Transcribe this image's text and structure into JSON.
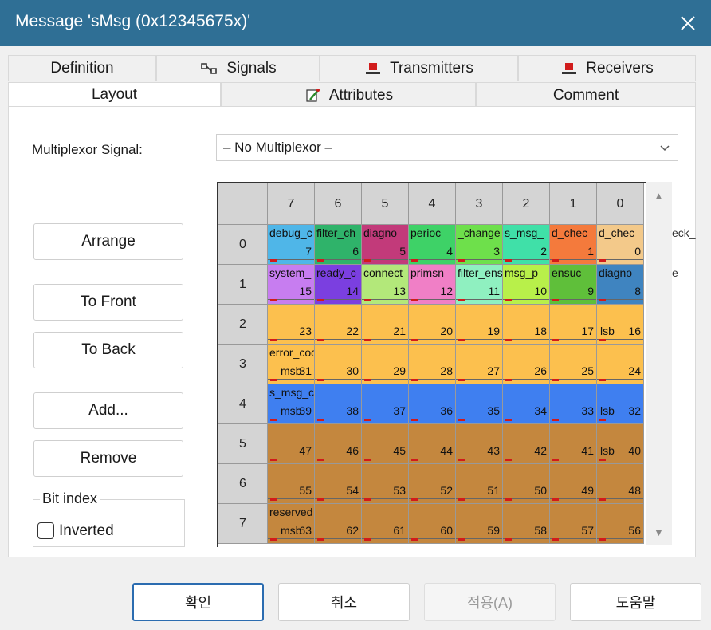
{
  "window": {
    "title": "Message 'sMsg (0x12345675x)'"
  },
  "tabs_row1": [
    {
      "label": "Definition",
      "icon": ""
    },
    {
      "label": "Signals",
      "icon": "signals-icon"
    },
    {
      "label": "Transmitters",
      "icon": "transmitter-icon"
    },
    {
      "label": "Receivers",
      "icon": "receiver-icon"
    }
  ],
  "tabs_row2": [
    {
      "label": "Layout",
      "icon": "",
      "active": true
    },
    {
      "label": "Attributes",
      "icon": "attributes-icon"
    },
    {
      "label": "Comment",
      "icon": ""
    }
  ],
  "multiplexor": {
    "label": "Multiplexor Signal:",
    "value": "– No Multiplexor –"
  },
  "buttons": {
    "arrange": "Arrange",
    "to_front": "To Front",
    "to_back": "To Back",
    "add": "Add...",
    "remove": "Remove"
  },
  "bit_index": {
    "group_title": "Bit index",
    "inverted_label": "Inverted",
    "inverted_checked": false
  },
  "grid": {
    "col_headers": [
      "7",
      "6",
      "5",
      "4",
      "3",
      "2",
      "1",
      "0"
    ],
    "row_headers": [
      "0",
      "1",
      "2",
      "3",
      "4",
      "5",
      "6",
      "7"
    ],
    "rows": [
      {
        "bits": [
          "7",
          "6",
          "5",
          "4",
          "3",
          "2",
          "1",
          "0"
        ],
        "colors": [
          "#4fb6e8",
          "#2fb36a",
          "#c23a7a",
          "#3ed267",
          "#6ee04b",
          "#40e0a8",
          "#f47a3c",
          "#f3c98a"
        ],
        "names": [
          "debug_c",
          "filter_ch",
          "diagno",
          "perioc",
          "_change",
          "s_msg_",
          "d_chec",
          "d_chec"
        ]
      },
      {
        "bits": [
          "15",
          "14",
          "13",
          "12",
          "11",
          "10",
          "9",
          "8"
        ],
        "colors": [
          "#c77df0",
          "#7b3fe0",
          "#b3e87a",
          "#f07fc6",
          "#8ff0c0",
          "#b8f04a",
          "#5fbf3a",
          "#3f84c0"
        ],
        "names": [
          "system_",
          "ready_c",
          "connect",
          "primsn",
          "filter_ens",
          "msg_p",
          "ensuc",
          "diagno"
        ]
      },
      {
        "bits": [
          "23",
          "22",
          "21",
          "20",
          "19",
          "18",
          "17",
          "16"
        ],
        "colors": [
          "#fcc04e",
          "#fcc04e",
          "#fcc04e",
          "#fcc04e",
          "#fcc04e",
          "#fcc04e",
          "#fcc04e",
          "#fcc04e"
        ],
        "names": [
          "",
          "",
          "",
          "",
          "",
          "",
          "",
          ""
        ],
        "lsb": "lsb"
      },
      {
        "bits": [
          "31",
          "30",
          "29",
          "28",
          "27",
          "26",
          "25",
          "24"
        ],
        "colors": [
          "#fcc04e",
          "#fcc04e",
          "#fcc04e",
          "#fcc04e",
          "#fcc04e",
          "#fcc04e",
          "#fcc04e",
          "#fcc04e"
        ],
        "names": [
          "error_code",
          "",
          "",
          "",
          "",
          "",
          "",
          ""
        ],
        "msb": "msb"
      },
      {
        "bits": [
          "39",
          "38",
          "37",
          "36",
          "35",
          "34",
          "33",
          "32"
        ],
        "colors": [
          "#3f7ff0",
          "#3f7ff0",
          "#3f7ff0",
          "#3f7ff0",
          "#3f7ff0",
          "#3f7ff0",
          "#3f7ff0",
          "#3f7ff0"
        ],
        "names": [
          "s_msg_counter",
          "",
          "",
          "",
          "",
          "",
          "",
          ""
        ],
        "msb": "msb",
        "lsb": "lsb"
      },
      {
        "bits": [
          "47",
          "46",
          "45",
          "44",
          "43",
          "42",
          "41",
          "40"
        ],
        "colors": [
          "#c4873e",
          "#c4873e",
          "#c4873e",
          "#c4873e",
          "#c4873e",
          "#c4873e",
          "#c4873e",
          "#c4873e"
        ],
        "names": [
          "",
          "",
          "",
          "",
          "",
          "",
          "",
          ""
        ],
        "lsb": "lsb"
      },
      {
        "bits": [
          "55",
          "54",
          "53",
          "52",
          "51",
          "50",
          "49",
          "48"
        ],
        "colors": [
          "#c4873e",
          "#c4873e",
          "#c4873e",
          "#c4873e",
          "#c4873e",
          "#c4873e",
          "#c4873e",
          "#c4873e"
        ],
        "names": [
          "",
          "",
          "",
          "",
          "",
          "",
          "",
          ""
        ]
      },
      {
        "bits": [
          "63",
          "62",
          "61",
          "60",
          "59",
          "58",
          "57",
          "56"
        ],
        "colors": [
          "#c4873e",
          "#c4873e",
          "#c4873e",
          "#c4873e",
          "#c4873e",
          "#c4873e",
          "#c4873e",
          "#c4873e"
        ],
        "names": [
          "reserved_future",
          "",
          "",
          "",
          "",
          "",
          "",
          ""
        ],
        "msb": "msb"
      }
    ],
    "overflow_text": [
      "eck_",
      "e"
    ]
  },
  "footer": {
    "ok": "확인",
    "cancel": "취소",
    "apply": "적용(A)",
    "help": "도움말"
  }
}
